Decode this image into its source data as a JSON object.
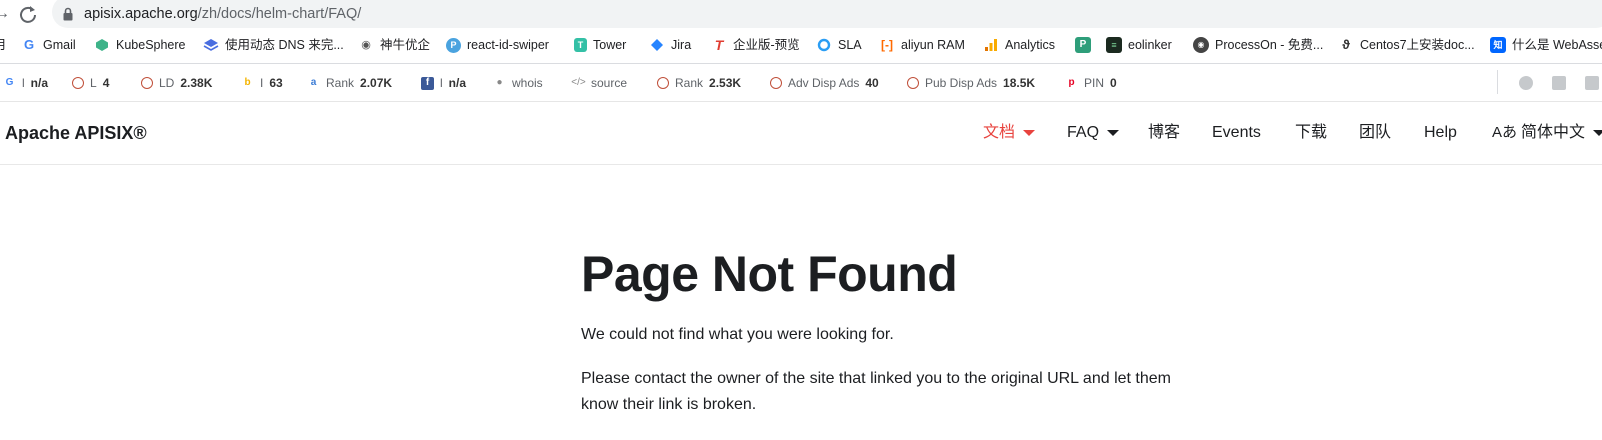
{
  "browser": {
    "url_host": "apisix.apache.org",
    "url_path": "/zh/docs/helm-chart/FAQ/"
  },
  "bookmarks": [
    {
      "label": "月",
      "icon": "bookmark-fragment"
    },
    {
      "label": "Gmail",
      "icon": "google-icon",
      "color": "#4285f4"
    },
    {
      "label": "KubeSphere",
      "icon": "kubesphere-icon",
      "color": "#3eb389"
    },
    {
      "label": "使用动态 DNS 来完...",
      "icon": "layers-icon",
      "color": "#4a6ee0"
    },
    {
      "label": "神牛优企",
      "icon": "cow-icon",
      "color": "#555555"
    },
    {
      "label": "react-id-swiper",
      "icon": "p-circle-icon",
      "color": "#4aa3df"
    },
    {
      "label": "Tower",
      "icon": "tower-icon",
      "color": "#34c0a6"
    },
    {
      "label": "Jira",
      "icon": "jira-icon",
      "color": "#2684ff"
    },
    {
      "label": "企业版-预览",
      "icon": "t-logo-icon",
      "color": "#e03c31"
    },
    {
      "label": "SLA",
      "icon": "ring-icon",
      "color": "#2a9df4"
    },
    {
      "label": "aliyun RAM",
      "icon": "aliyun-icon",
      "color": "#ff6a00"
    },
    {
      "label": "Analytics",
      "icon": "analytics-icon",
      "color": "#f9ab00"
    },
    {
      "label": "",
      "icon": "pastel-icon",
      "color": "#2e9e7a"
    },
    {
      "label": "eolinker",
      "icon": "eolinker-icon",
      "color": "#1b2a20"
    },
    {
      "label": "ProcessOn - 免费...",
      "icon": "processon-icon",
      "color": "#444444"
    },
    {
      "label": "Centos7上安装doc...",
      "icon": "spiral-icon",
      "color": "#333333"
    },
    {
      "label": "什么是 WebAsse",
      "icon": "zhihu-icon",
      "color": "#0066ff"
    }
  ],
  "seo_bar": [
    {
      "prefix": "l",
      "value": "n/a",
      "icon": "google-icon"
    },
    {
      "prefix": "L",
      "value": "4",
      "icon": "circle-icon"
    },
    {
      "prefix": "LD",
      "value": "2.38K",
      "icon": "circle-icon"
    },
    {
      "prefix": "I",
      "value": "63",
      "icon": "bing-icon"
    },
    {
      "prefix": "Rank",
      "value": "2.07K",
      "icon": "alexa-icon"
    },
    {
      "prefix": "l",
      "value": "n/a",
      "icon": "facebook-icon"
    },
    {
      "prefix": "whois",
      "value": "",
      "icon": "user-icon"
    },
    {
      "prefix": "source",
      "value": "",
      "icon": "code-icon"
    },
    {
      "prefix": "Rank",
      "value": "2.53K",
      "icon": "circle-icon"
    },
    {
      "prefix": "Adv Disp Ads",
      "value": "40",
      "icon": "circle-icon"
    },
    {
      "prefix": "Pub Disp Ads",
      "value": "18.5K",
      "icon": "circle-icon"
    },
    {
      "prefix": "PIN",
      "value": "0",
      "icon": "pinterest-icon"
    }
  ],
  "navbar": {
    "brand": "Apache APISIX®",
    "items": [
      {
        "label": "文档",
        "dropdown": true,
        "active": true
      },
      {
        "label": "FAQ",
        "dropdown": true,
        "active": false
      },
      {
        "label": "博客",
        "dropdown": false,
        "active": false
      },
      {
        "label": "Events",
        "dropdown": false,
        "active": false
      },
      {
        "label": "下载",
        "dropdown": false,
        "active": false
      },
      {
        "label": "团队",
        "dropdown": false,
        "active": false
      },
      {
        "label": "Help",
        "dropdown": false,
        "active": false
      },
      {
        "label": "简体中文",
        "dropdown": true,
        "active": false,
        "icon": "translate-icon"
      }
    ],
    "active_color": "#e8433e"
  },
  "main": {
    "title": "Page Not Found",
    "para1": "We could not find what you were looking for.",
    "para2": "Please contact the owner of the site that linked you to the original URL and let them know their link is broken."
  }
}
